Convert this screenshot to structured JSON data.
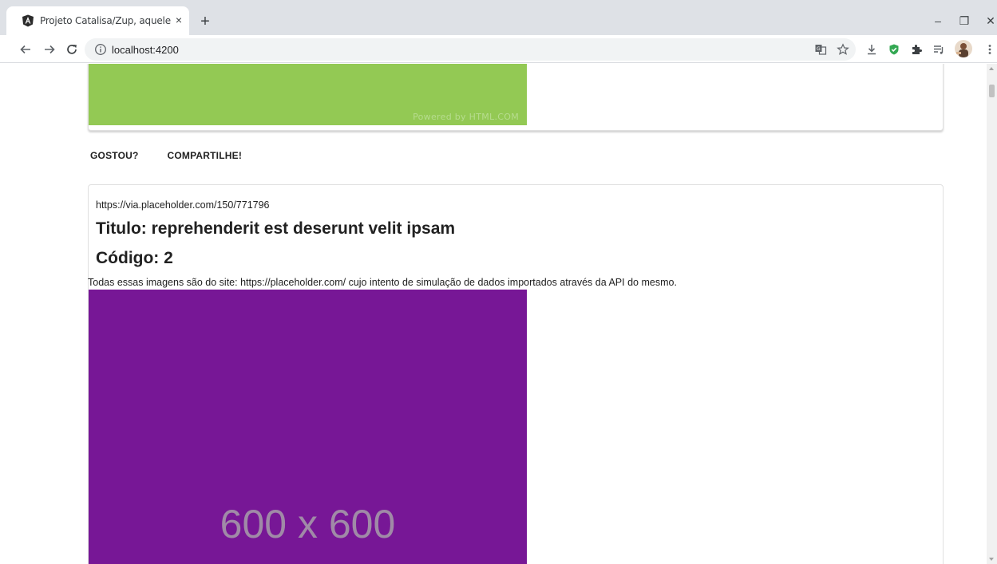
{
  "browser": {
    "tab_title": "Projeto Catalisa/Zup, aquele que",
    "tab_close": "×",
    "new_tab": "+",
    "url": "localhost:4200",
    "window_controls": {
      "minimize": "–",
      "maximize": "❐",
      "close": "✕"
    },
    "icons": [
      "angular-favicon-icon",
      "back-icon",
      "forward-icon",
      "reload-icon",
      "info-icon",
      "translate-icon",
      "star-icon",
      "download-icon",
      "shield-icon",
      "extensions-icon",
      "playlist-icon",
      "avatar",
      "menu-icon"
    ],
    "accent_colors": {
      "shield": "#34a853",
      "tab_strip": "#dee1e6"
    }
  },
  "page": {
    "top_card": {
      "image_color": "#93c954",
      "powered_text": "Powered by HTML.COM"
    },
    "actions": [
      {
        "label": "GOSTOU?"
      },
      {
        "label": "COMPARTILHE!"
      }
    ],
    "card": {
      "image_url": "https://via.placeholder.com/150/771796",
      "title": "Titulo: reprehenderit est deserunt velit ipsam",
      "code": "Código: 2",
      "description": "Todas essas imagens são do site: https://placeholder.com/ cujo intento de simulação de dados importados através da API do mesmo.",
      "image_color": "#771796",
      "image_text": "600 x 600"
    }
  }
}
